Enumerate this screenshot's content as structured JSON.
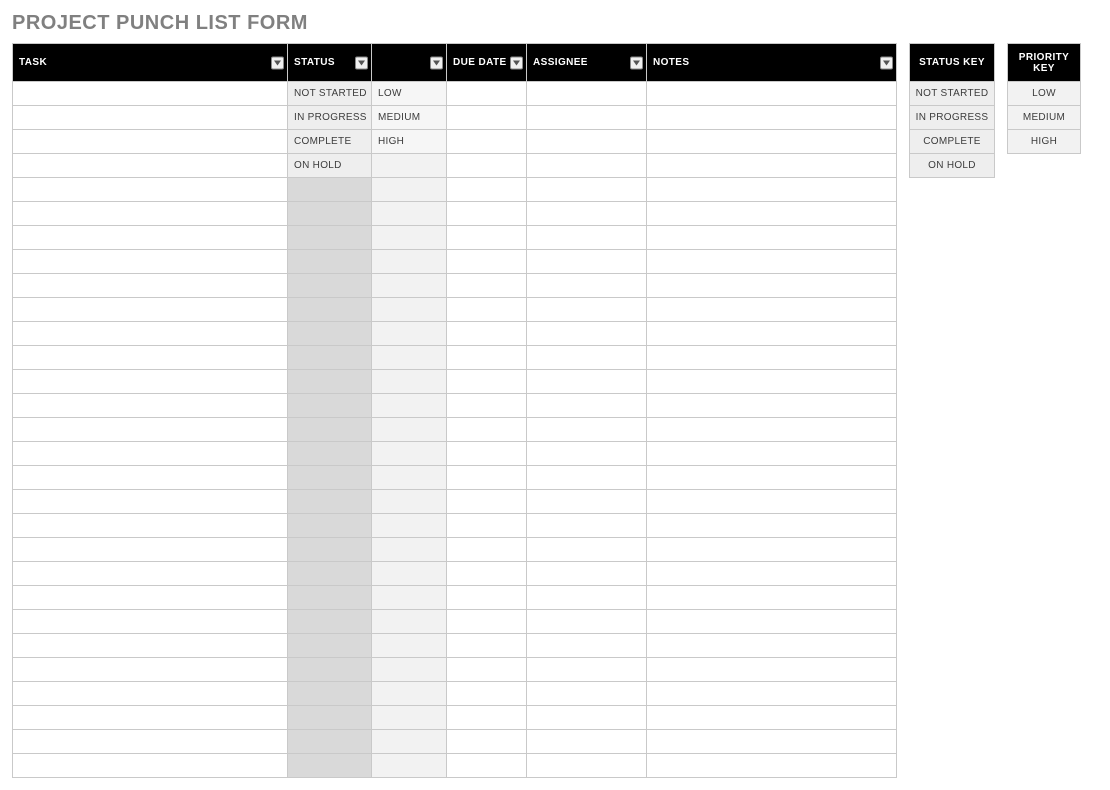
{
  "title": "PROJECT PUNCH LIST FORM",
  "columns": {
    "task": "TASK",
    "status": "STATUS",
    "priority": "",
    "due": "DUE DATE",
    "assignee": "ASSIGNEE",
    "notes": "NOTES"
  },
  "status_options": [
    "NOT STARTED",
    "IN PROGRESS",
    "COMPLETE",
    "ON HOLD"
  ],
  "priority_options": [
    "LOW",
    "MEDIUM",
    "HIGH"
  ],
  "empty_rows": 25,
  "status_key": {
    "header": "STATUS KEY",
    "items": [
      "NOT STARTED",
      "IN PROGRESS",
      "COMPLETE",
      "ON HOLD"
    ]
  },
  "priority_key": {
    "header": "PRIORITY KEY",
    "items": [
      "LOW",
      "MEDIUM",
      "HIGH"
    ]
  }
}
